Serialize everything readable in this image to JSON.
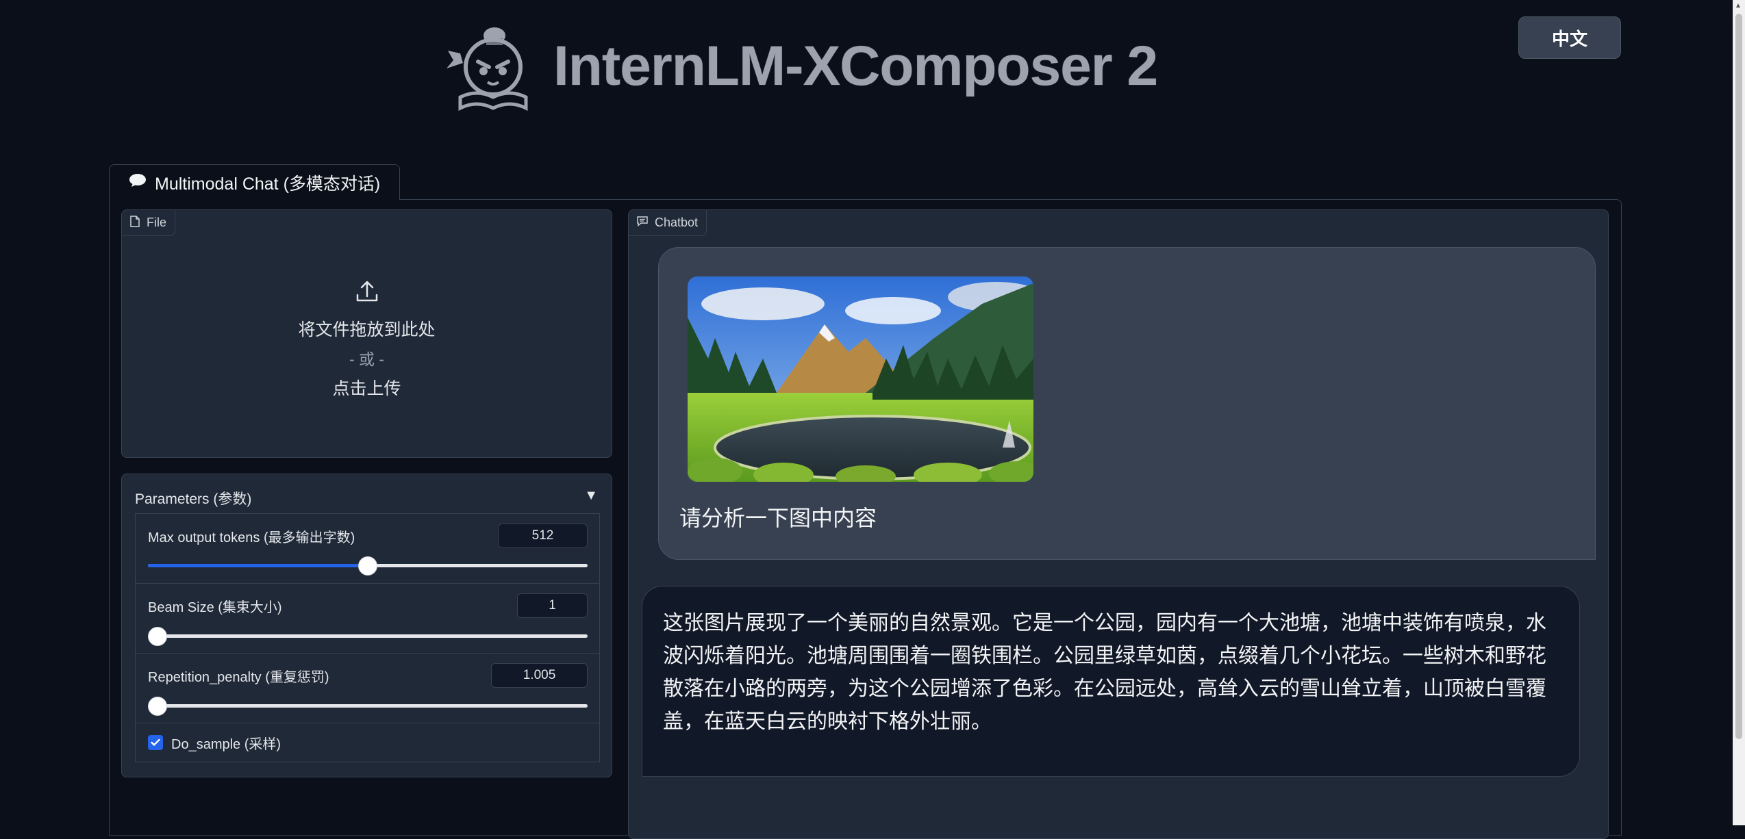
{
  "header": {
    "app_title": "InternLM-XComposer 2",
    "language_button": "中文",
    "logo_icon": "mascot-reading-book-logo"
  },
  "tabs": [
    {
      "label": "Multimodal Chat (多模态对话)",
      "icon": "speech-bubble-icon",
      "active": true
    }
  ],
  "file_upload": {
    "label": "File",
    "icon": "file-icon",
    "drop_text": "将文件拖放到此处",
    "or_text": "- 或 -",
    "click_text": "点击上传",
    "upload_icon": "upload-icon"
  },
  "parameters": {
    "title": "Parameters (参数)",
    "toggle": "▼",
    "max_tokens": {
      "label": "Max output tokens (最多输出字数)",
      "value": "512",
      "fraction": 0.5
    },
    "beam_size": {
      "label": "Beam Size (集束大小)",
      "value": "1",
      "fraction": 0.0
    },
    "repetition_penalty": {
      "label": "Repetition_penalty (重复惩罚)",
      "value": "1.005",
      "fraction": 0.005
    },
    "do_sample": {
      "label": "Do_sample (采样)",
      "checked": true
    }
  },
  "chatbot": {
    "label": "Chatbot",
    "icon": "chat-icon",
    "user_message": "请分析一下图中内容",
    "bot_message": "这张图片展现了一个美丽的自然景观。它是一个公园，园内有一个大池塘，池塘中装饰有喷泉，水波闪烁着阳光。池塘周围围着一圈铁围栏。公园里绿草如茵，点缀着几个小花坛。一些树木和野花散落在小路的两旁，为这个公园增添了色彩。在公园远处，高耸入云的雪山耸立着，山顶被白雪覆盖，在蓝天白云的映衬下格外壮丽。"
  },
  "colors": {
    "background": "#0b0f19",
    "block": "#1f2937",
    "accent": "#2563eb"
  }
}
